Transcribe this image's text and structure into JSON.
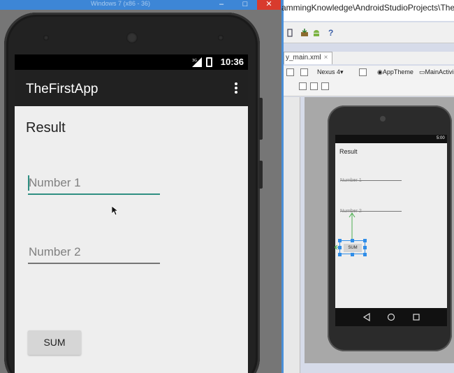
{
  "emulator": {
    "window_title": "Windows 7 (x86 - 36)",
    "controls": {
      "minimize": "–",
      "maximize": "□",
      "close": "✕"
    },
    "status_bar": {
      "time": "10:36",
      "network": "3G"
    },
    "app_bar": {
      "title": "TheFirstApp",
      "overflow_icon": "overflow-menu-icon"
    },
    "content": {
      "result_label": "Result",
      "number1_placeholder": "Number 1",
      "number2_placeholder": "Number 2",
      "sum_button": "SUM"
    },
    "colors": {
      "accent": "#2f8f82",
      "app_bar": "#212121",
      "status_bar": "#000000",
      "screen_bg": "#eeeeee"
    }
  },
  "studio": {
    "title_path": "ammingKnowledge\\AndroidStudioProjects\\TheFirs",
    "editor_tab": {
      "label": "y_main.xml",
      "close": "×"
    },
    "config_bar": {
      "device": "Nexus 4",
      "theme": "AppTheme",
      "activity": "MainActivi"
    },
    "help_icon": "?",
    "preview": {
      "status_time": "5:00",
      "result_label": "Result",
      "number1_hint": "Number 1",
      "number2_hint": "Number 2",
      "sum_button": "SUM"
    },
    "colors": {
      "selection": "#2f8de8",
      "constraint": "#4caf50"
    }
  }
}
